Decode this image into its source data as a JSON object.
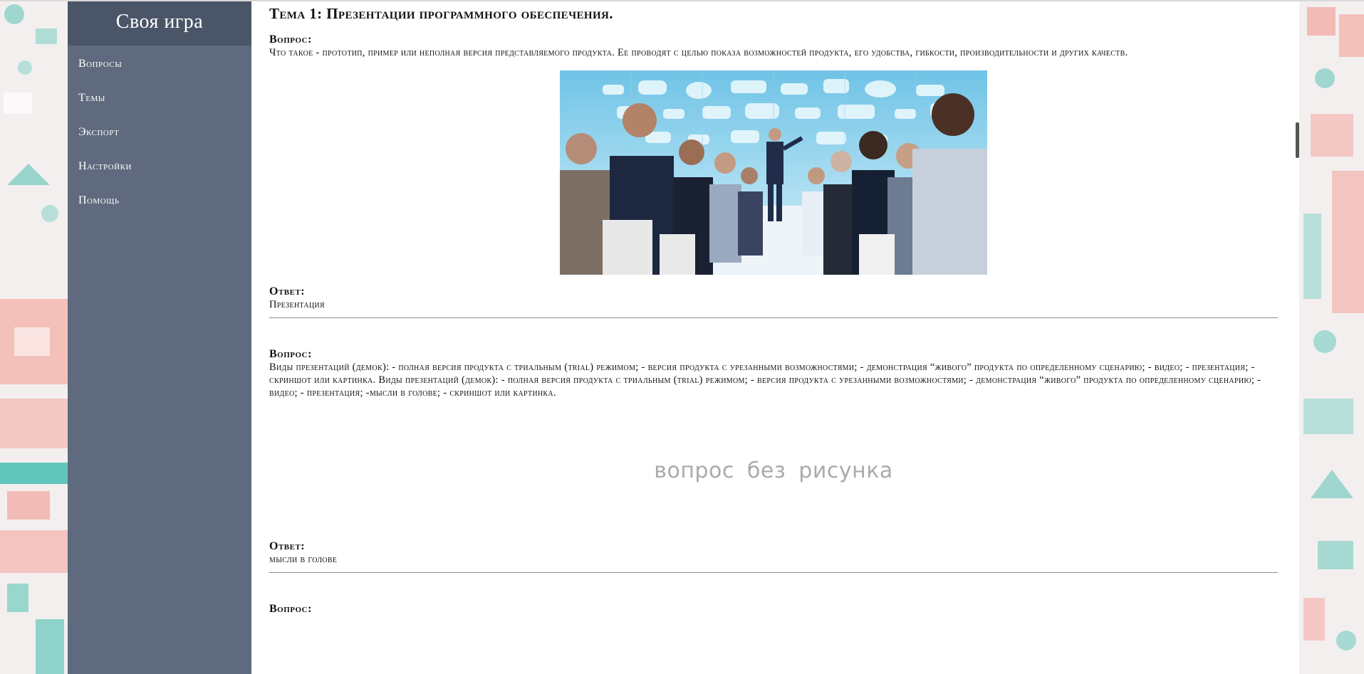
{
  "sidebar": {
    "title": "Своя игра",
    "items": [
      {
        "label": "Вопросы"
      },
      {
        "label": "Темы"
      },
      {
        "label": "Экспорт"
      },
      {
        "label": "Настройки"
      },
      {
        "label": "Помощь"
      }
    ]
  },
  "main": {
    "theme_title": "Тема 1: Презентации программного обеспечения.",
    "questions": [
      {
        "question_label": "Вопрос:",
        "question_text": "Что такое - прототип, пример или неполная версия представляемого продукта. Ее проводят с целью показа возможностей продукта, его удобства, гибкости, производительности и других качеств.",
        "answer_label": "Ответ:",
        "answer_text": "Презентация"
      },
      {
        "question_label": "Вопрос:",
        "question_text": "Виды презентаций (демок): - полная версия продукта с триальным (trial) режимом; - версия продукта с урезанными возможностями; - демонстрация “живого” продукта по определенному сценарию; - видео; - презентация; - скриншот или картинка. Виды презентаций (демок): - полная версия продукта с триальным (trial) режимом; - версия продукта с урезанными возможностями; - демонстрация “живого” продукта по определенному сценарию; - видео; - презентация; -мысли в голове; - скриншот или картинка.",
        "no_image_text": "вопрос без рисунка",
        "answer_label": "Ответ:",
        "answer_text": "мысли в голове"
      },
      {
        "question_label": "Вопрос:"
      }
    ]
  },
  "colors": {
    "sidebar": "#5f6a7e",
    "sidebar_header": "#4b5568",
    "bg_teal": "#1fb5a3",
    "bg_coral": "#f07f76"
  }
}
